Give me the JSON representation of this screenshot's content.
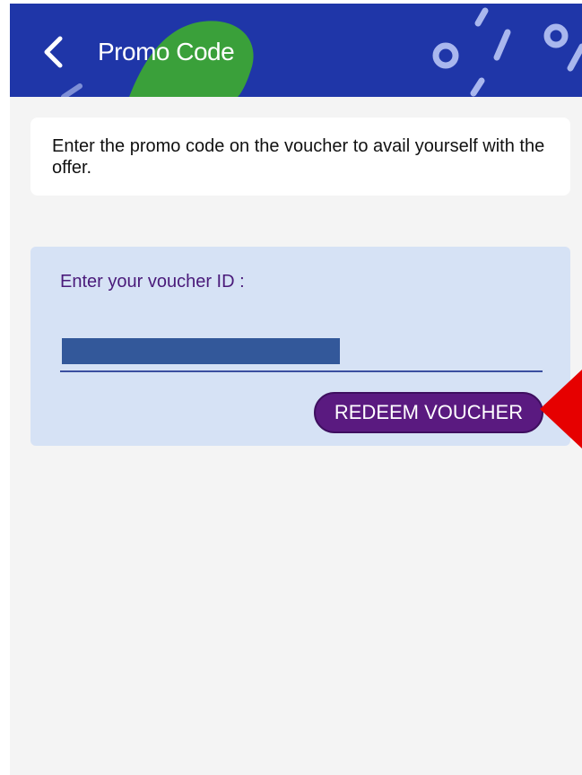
{
  "header": {
    "title": "Promo Code",
    "back_icon": "chevron-left-icon",
    "background_color": "#1f36a8"
  },
  "info": {
    "text": "Enter the promo code on the voucher to avail yourself with the offer."
  },
  "voucher": {
    "label": "Enter your voucher ID :",
    "input_value": "",
    "redeem_label": "REDEEM VOUCHER",
    "button_color": "#5a1a80",
    "card_color": "#d6e2f5"
  },
  "annotation": {
    "icon": "red-arrow-pointer-icon",
    "color": "#e60000"
  }
}
